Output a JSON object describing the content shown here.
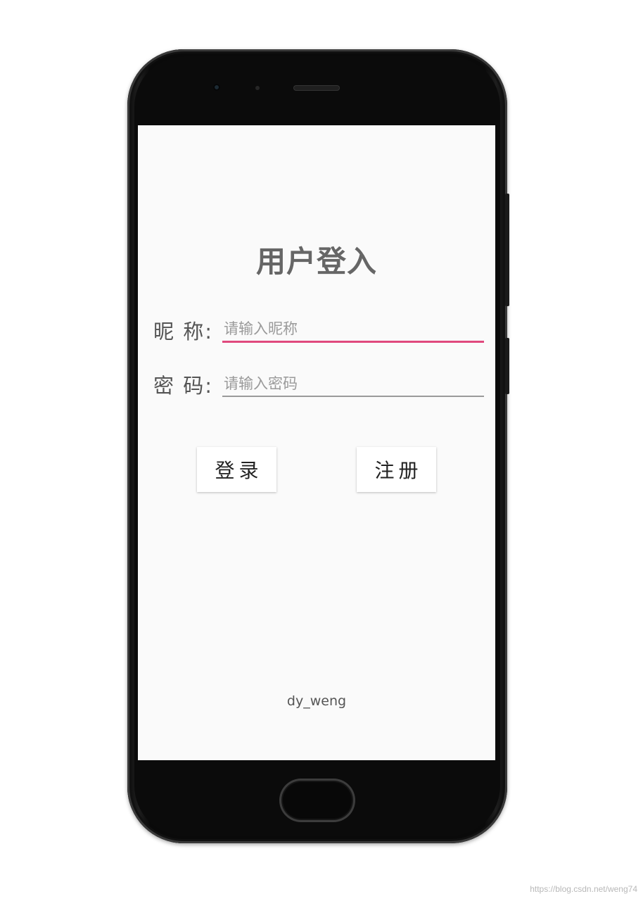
{
  "screen": {
    "title": "用户登入",
    "nickname": {
      "label": "昵 称:",
      "placeholder": "请输入昵称",
      "value": ""
    },
    "password": {
      "label": "密 码:",
      "placeholder": "请输入密码",
      "value": ""
    },
    "buttons": {
      "login": "登录",
      "register": "注册"
    },
    "footer": "dy_weng"
  },
  "watermark": "https://blog.csdn.net/weng74",
  "colors": {
    "accent_underline": "#e0497d",
    "title": "#666666",
    "screen_background": "#fafafa"
  },
  "icons": [
    "front-camera-icon",
    "earpiece-speaker-icon",
    "home-button-icon"
  ]
}
